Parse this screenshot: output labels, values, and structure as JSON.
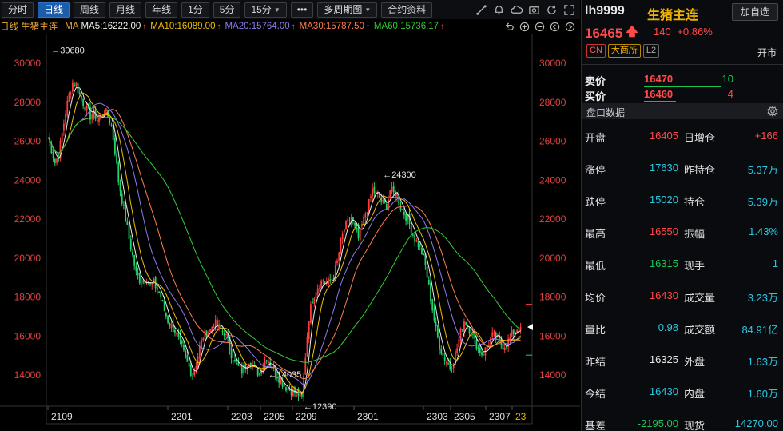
{
  "toolbar": {
    "periods": [
      "分时",
      "日线",
      "周线",
      "月线",
      "年线",
      "1分",
      "5分"
    ],
    "active_period": "日线",
    "min_select": "15分",
    "more": "•••",
    "multi": "多周期图",
    "contract_info": "合约资料"
  },
  "ma_legend": {
    "title": "日线 生猪主连",
    "label": "MA",
    "items": [
      {
        "text": "MA5:16222.00",
        "color": "#f0f0f0"
      },
      {
        "text": "MA10:16089.00",
        "color": "#f0c000"
      },
      {
        "text": "MA20:15764.00",
        "color": "#8c7cf0"
      },
      {
        "text": "MA30:15787.50",
        "color": "#ff7f50"
      },
      {
        "text": "MA60:15736.17",
        "color": "#33cc33"
      }
    ],
    "arrow": "↑"
  },
  "chart_data": {
    "type": "candlestick",
    "title": "",
    "ylim": [
      12400,
      31200
    ],
    "yticks_left": [
      "30000",
      "28000",
      "26000",
      "24000",
      "22000",
      "20000",
      "18000",
      "16000",
      "14000"
    ],
    "yticks_right": [
      "30000",
      "28000",
      "26000",
      "24000",
      "22000",
      "20000",
      "18000",
      "16000",
      "14000"
    ],
    "x_labels": [
      "2109",
      "2201",
      "2203",
      "2205",
      "2209",
      "2301",
      "2303",
      "2305",
      "2307",
      "23"
    ],
    "annotations": [
      {
        "text": "←30680",
        "value": 30680
      },
      {
        "text": "←24300",
        "value": 24300
      },
      {
        "text": "←14035",
        "value": 14035
      },
      {
        "text": "←12390",
        "value": 12390
      }
    ],
    "close_path": [
      [
        0,
        26200
      ],
      [
        2,
        25600
      ],
      [
        4,
        24900
      ],
      [
        6,
        25300
      ],
      [
        8,
        26400
      ],
      [
        10,
        27500
      ],
      [
        12,
        28400
      ],
      [
        14,
        29000
      ],
      [
        16,
        28900
      ],
      [
        18,
        28400
      ],
      [
        20,
        28000
      ],
      [
        22,
        27600
      ],
      [
        24,
        27300
      ],
      [
        26,
        27500
      ],
      [
        28,
        27100
      ],
      [
        30,
        27300
      ],
      [
        32,
        27600
      ],
      [
        34,
        27300
      ],
      [
        36,
        26800
      ],
      [
        38,
        25500
      ],
      [
        40,
        24000
      ],
      [
        42,
        23000
      ],
      [
        44,
        22000
      ],
      [
        46,
        21000
      ],
      [
        48,
        20100
      ],
      [
        50,
        19200
      ],
      [
        52,
        18900
      ],
      [
        54,
        18800
      ],
      [
        56,
        19000
      ],
      [
        58,
        18600
      ],
      [
        60,
        18700
      ],
      [
        62,
        18400
      ],
      [
        64,
        18000
      ],
      [
        66,
        17300
      ],
      [
        68,
        16800
      ],
      [
        70,
        16500
      ],
      [
        72,
        16300
      ],
      [
        74,
        15800
      ],
      [
        76,
        15400
      ],
      [
        78,
        14800
      ],
      [
        80,
        14400
      ],
      [
        82,
        14000
      ],
      [
        84,
        14600
      ],
      [
        86,
        15400
      ],
      [
        88,
        16000
      ],
      [
        90,
        16200
      ],
      [
        92,
        16300
      ],
      [
        94,
        16700
      ],
      [
        96,
        16500
      ],
      [
        98,
        16300
      ],
      [
        100,
        16200
      ],
      [
        102,
        15700
      ],
      [
        104,
        15100
      ],
      [
        106,
        14600
      ],
      [
        108,
        14400
      ],
      [
        110,
        14200
      ],
      [
        112,
        14500
      ],
      [
        114,
        14800
      ],
      [
        116,
        14500
      ],
      [
        118,
        14200
      ],
      [
        120,
        14100
      ],
      [
        122,
        14500
      ],
      [
        124,
        14900
      ],
      [
        126,
        14600
      ],
      [
        128,
        14300
      ],
      [
        130,
        14000
      ],
      [
        132,
        13700
      ],
      [
        134,
        13500
      ],
      [
        136,
        13300
      ],
      [
        138,
        13200
      ],
      [
        140,
        13100
      ],
      [
        142,
        13000
      ],
      [
        144,
        12800
      ],
      [
        146,
        15000
      ],
      [
        148,
        17000
      ],
      [
        150,
        17900
      ],
      [
        152,
        18400
      ],
      [
        154,
        18700
      ],
      [
        156,
        18900
      ],
      [
        158,
        18700
      ],
      [
        160,
        18800
      ],
      [
        162,
        19100
      ],
      [
        164,
        19800
      ],
      [
        166,
        20800
      ],
      [
        168,
        21500
      ],
      [
        170,
        21800
      ],
      [
        172,
        22100
      ],
      [
        174,
        21500
      ],
      [
        176,
        21000
      ],
      [
        178,
        21600
      ],
      [
        180,
        22300
      ],
      [
        182,
        22800
      ],
      [
        184,
        23500
      ],
      [
        186,
        23300
      ],
      [
        188,
        23100
      ],
      [
        190,
        22800
      ],
      [
        192,
        22700
      ],
      [
        194,
        23500
      ],
      [
        196,
        23300
      ],
      [
        198,
        23200
      ],
      [
        200,
        22600
      ],
      [
        202,
        22300
      ],
      [
        204,
        22000
      ],
      [
        206,
        21500
      ],
      [
        208,
        21000
      ],
      [
        210,
        20700
      ],
      [
        212,
        20300
      ],
      [
        214,
        19600
      ],
      [
        216,
        18500
      ],
      [
        218,
        17400
      ],
      [
        220,
        16300
      ],
      [
        222,
        15500
      ],
      [
        224,
        15000
      ],
      [
        226,
        14700
      ],
      [
        228,
        14400
      ],
      [
        230,
        14800
      ],
      [
        232,
        15400
      ],
      [
        234,
        16200
      ],
      [
        236,
        16800
      ],
      [
        238,
        16600
      ],
      [
        240,
        16200
      ],
      [
        242,
        15700
      ],
      [
        244,
        15400
      ],
      [
        246,
        15100
      ],
      [
        248,
        15300
      ],
      [
        250,
        15700
      ],
      [
        252,
        16000
      ],
      [
        254,
        15900
      ],
      [
        256,
        15700
      ],
      [
        258,
        15500
      ],
      [
        260,
        15600
      ],
      [
        262,
        15900
      ],
      [
        264,
        16200
      ],
      [
        266,
        16400
      ],
      [
        268,
        16465
      ]
    ]
  },
  "panel": {
    "symbol": "lh9999",
    "name": "生猪主连",
    "add_button": "加自选",
    "price": "16465",
    "change": "140",
    "change_pct": "+0.86%",
    "tag_cn": "CN",
    "tag_exchange": "大商所",
    "tag_level": "L2",
    "status": "开市",
    "sell_label": "卖价",
    "sell_price": "16470",
    "sell_vol": "10",
    "buy_label": "买价",
    "buy_price": "16460",
    "buy_vol": "4",
    "section_title": "盘口数据",
    "rows": [
      {
        "l1": "开盘",
        "v1": "16405",
        "c1": "red",
        "l2": "日增仓",
        "v2": "+166",
        "c2": "red"
      },
      {
        "l1": "涨停",
        "v1": "17630",
        "c1": "cyan",
        "l2": "昨持仓",
        "v2": "5.37万",
        "c2": "cyan"
      },
      {
        "l1": "跌停",
        "v1": "15020",
        "c1": "cyan",
        "l2": "持仓",
        "v2": "5.39万",
        "c2": "cyan"
      },
      {
        "l1": "最高",
        "v1": "16550",
        "c1": "red",
        "l2": "振幅",
        "v2": "1.43%",
        "c2": "cyan"
      },
      {
        "l1": "最低",
        "v1": "16315",
        "c1": "green",
        "l2": "现手",
        "v2": "1",
        "c2": "cyan"
      },
      {
        "l1": "均价",
        "v1": "16430",
        "c1": "red",
        "l2": "成交量",
        "v2": "3.23万",
        "c2": "cyan"
      },
      {
        "l1": "量比",
        "v1": "0.98",
        "c1": "cyan",
        "l2": "成交额",
        "v2": "84.91亿",
        "c2": "cyan"
      },
      {
        "l1": "昨结",
        "v1": "16325",
        "c1": "white",
        "l2": "外盘",
        "v2": "1.63万",
        "c2": "cyan"
      },
      {
        "l1": "今结",
        "v1": "16430",
        "c1": "cyan",
        "l2": "内盘",
        "v2": "1.60万",
        "c2": "cyan"
      },
      {
        "l1": "基差",
        "v1": "-2195.00",
        "c1": "green",
        "l2": "现货",
        "v2": "14270.00",
        "c2": "cyan"
      }
    ]
  }
}
